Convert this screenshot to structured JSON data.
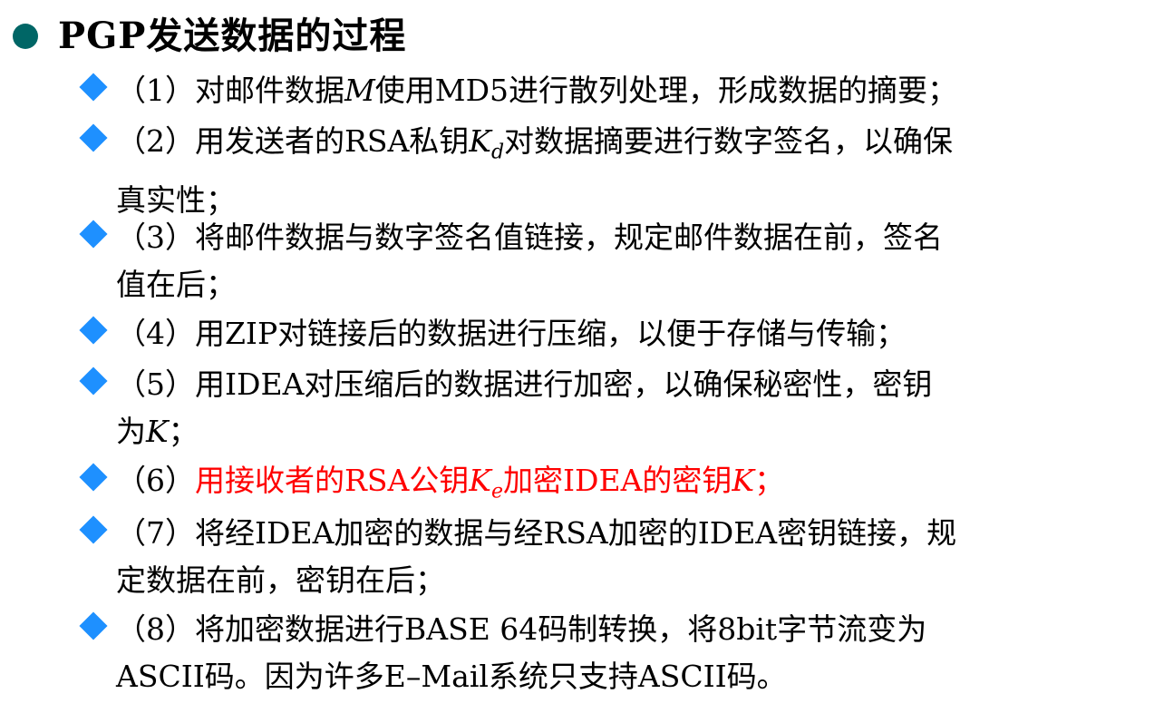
{
  "title": "PGP发送数据的过程",
  "colors": {
    "title_bullet": "#006666",
    "item_bullet": "#1e90ff",
    "highlight": "#ff0000"
  },
  "items": [
    {
      "num": "（1）",
      "a": "对邮件数据",
      "b": "M",
      "c": "使用MD5进行散列处理，形成数据的摘要；"
    },
    {
      "num": "（2）",
      "a": "用发送者的RSA私钥",
      "b": "K",
      "sub": "d",
      "c": "对数据摘要进行数字签名，以确保",
      "cont": "真实性；"
    },
    {
      "num": "（3）",
      "a": "将邮件数据与数字签名值链接，规定邮件数据在前，签名",
      "cont": "值在后；"
    },
    {
      "num": "（4）",
      "a": "用ZIP对链接后的数据进行压缩，以便于存储与传输；"
    },
    {
      "num": "（5）",
      "a": "用IDEA对压缩后的数据进行加密，以确保秘密性，密钥",
      "cont_a": "为",
      "cont_b": "K",
      "cont_c": "；"
    },
    {
      "num": "（6）",
      "a": "用接收者的RSA公钥",
      "b": "K",
      "sub": "e",
      "c": "加密IDEA的密钥",
      "d": "K",
      "e": "；"
    },
    {
      "num": "（7）",
      "a": "将经IDEA加密的数据与经RSA加密的IDEA密钥链接，规",
      "cont": "定数据在前，密钥在后；"
    },
    {
      "num": "（8）",
      "a": "将加密数据进行BASE 64码制转换，将8bit字节流变为",
      "cont": "ASCII码。因为许多E–Mail系统只支持ASCII码。"
    }
  ]
}
